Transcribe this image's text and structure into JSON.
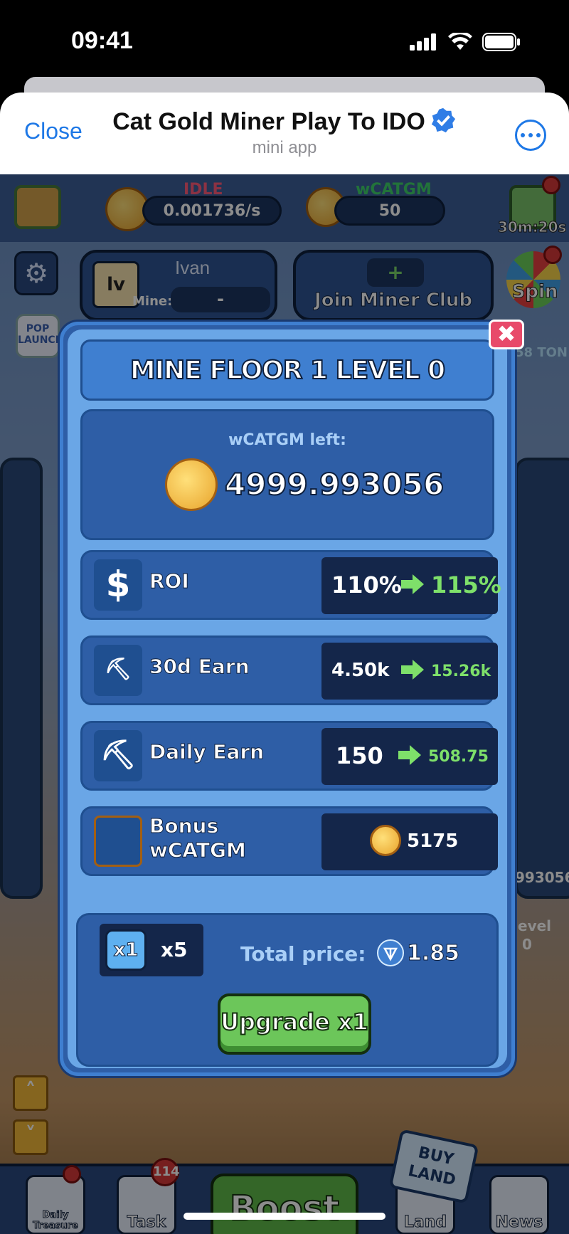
{
  "status_bar": {
    "time": "09:41"
  },
  "header": {
    "close_label": "Close",
    "title": "Cat Gold Miner Play To IDO",
    "subtitle": "mini app"
  },
  "game": {
    "idle_label": "IDLE",
    "idle_value": "0.001736/s",
    "token_label": "wCATGM",
    "token_value": "50",
    "timer": "30m:20s",
    "player_badge": "lv",
    "player_name": "Ivan",
    "miner_label": "Mine:",
    "miner_value": "-",
    "club_label": "Join Miner Club",
    "spin_label": "Spin",
    "ton_strip": "58 TON",
    "side_value": "993056",
    "side_level_label": "evel",
    "side_level_value": "0",
    "pop_label": "POP LAUNCH",
    "boost_label": "Boost",
    "buy_land_label": "BUY LAND",
    "nav": [
      {
        "label": "Daily Treasure"
      },
      {
        "label": "Task",
        "badge": "114"
      },
      {
        "label": "Land"
      },
      {
        "label": "News"
      }
    ]
  },
  "modal": {
    "title": "MINE FLOOR 1 LEVEL 0",
    "left_label": "wCATGM left:",
    "left_value": "4999.993056",
    "rows": [
      {
        "label": "ROI",
        "from": "110%",
        "to": "115%",
        "icon": "dollar-icon"
      },
      {
        "label": "30d Earn",
        "from": "4.50k",
        "to": "15.26k",
        "icon": "carts-icon"
      },
      {
        "label": "Daily Earn",
        "from": "150",
        "to": "508.75",
        "icon": "pickaxe-icon"
      },
      {
        "label": "Bonus wCATGM",
        "value": "5175",
        "icon": "cat-coin-icon"
      }
    ],
    "multiplier_active": "x1",
    "multiplier_alt": "x5",
    "total_label": "Total price:",
    "total_value": "1.85",
    "upgrade_label": "Upgrade  x1"
  },
  "colors": {
    "accent_green": "#7ee06a",
    "panel_blue": "#2e5ea6",
    "link_blue": "#1e78e6"
  }
}
